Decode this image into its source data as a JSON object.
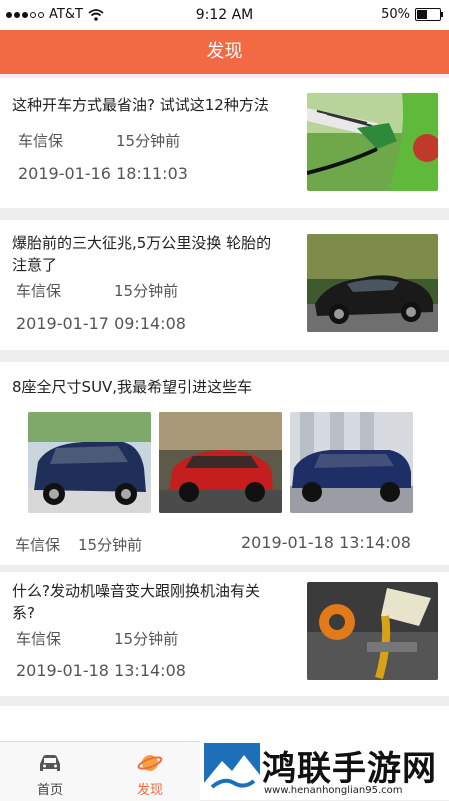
{
  "status_bar": {
    "carrier": "AT&T",
    "time": "9:12 AM",
    "battery": "50%",
    "battery_level": 0.5
  },
  "header": {
    "title": "发现"
  },
  "articles": [
    {
      "title": "这种开车方式最省油? 试试这12种方法",
      "source": "车信保",
      "ago": "15分钟前",
      "date": "2019-01-16 18:11:03"
    },
    {
      "title_lines": [
        "爆胎前的三大征兆,5万公里没换 轮胎的",
        "注意了"
      ],
      "source": "车信保",
      "ago": "15分钟前",
      "date": "2019-01-17 09:14:08"
    },
    {
      "title": "8座全尺寸SUV,我最希望引进这些车",
      "source": "车信保",
      "ago": "15分钟前",
      "date": "2019-01-18 13:14:08"
    },
    {
      "title_lines": [
        "什么?发动机噪音变大跟刚换机油有关",
        "系?"
      ],
      "source": "车信保",
      "ago": "15分钟前",
      "date": "2019-01-18 13:14:08"
    }
  ],
  "tabs": {
    "home": "首页",
    "discover": "发现"
  },
  "watermark": {
    "name": "鸿联手游网",
    "url": "www.henanhonglian95.com"
  },
  "colors": {
    "accent": "#f26a44",
    "background": "#eeeeee"
  }
}
